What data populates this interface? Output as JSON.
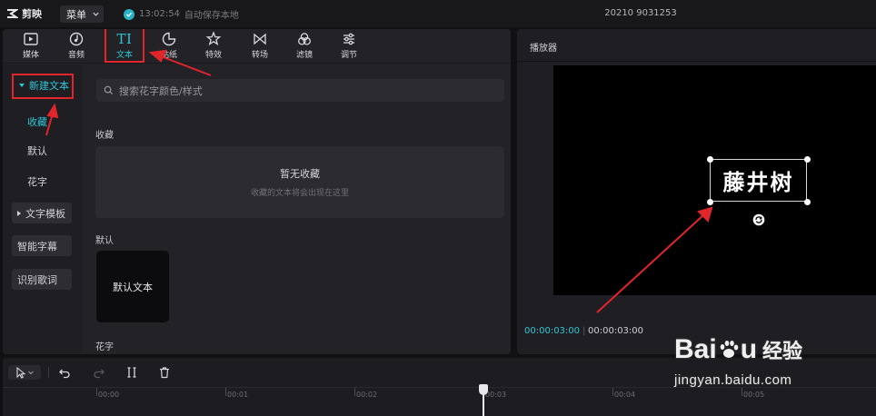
{
  "app": {
    "name": "剪映",
    "menu_label": "菜单",
    "save_time": "13:02:54",
    "save_text": "自动保存本地",
    "project_title": "20210 9031253"
  },
  "tool_tabs": [
    {
      "label": "媒体",
      "icon": "media-icon"
    },
    {
      "label": "音频",
      "icon": "audio-icon"
    },
    {
      "label": "文本",
      "icon": "text-icon",
      "active": true
    },
    {
      "label": "贴纸",
      "icon": "sticker-icon"
    },
    {
      "label": "特效",
      "icon": "effects-icon"
    },
    {
      "label": "转场",
      "icon": "transition-icon"
    },
    {
      "label": "滤镜",
      "icon": "filter-icon"
    },
    {
      "label": "调节",
      "icon": "adjust-icon"
    }
  ],
  "side_nav": {
    "new_text": "新建文本",
    "favorites": "收藏",
    "default": "默认",
    "fancy_text": "花字",
    "text_templates": "文字模板",
    "smart_subtitles": "智能字幕",
    "lyrics": "识别歌词"
  },
  "content": {
    "search_placeholder": "搜索花字颜色/样式",
    "favorites_title": "收藏",
    "favorites_empty": "暂无收藏",
    "favorites_hint": "收藏的文本将会出现在这里",
    "default_title": "默认",
    "default_card": "默认文本",
    "fancy_title": "花字"
  },
  "player": {
    "title": "播放器",
    "caption": "藤井树",
    "current_time": "00:00:03:00",
    "separator": "|",
    "total_time": "00:00:03:00"
  },
  "timeline": {
    "ticks": [
      "00:00",
      "00:01",
      "00:02",
      "00:03",
      "00:04",
      "00:05"
    ]
  },
  "watermark": {
    "brand_a": "Bai",
    "brand_b": "u",
    "brand_cn": "经验",
    "url": "jingyan.baidu.com"
  },
  "colors": {
    "accent": "#2dc6d7",
    "highlight": "#e2252b",
    "panel": "#232327",
    "background": "#111113"
  }
}
